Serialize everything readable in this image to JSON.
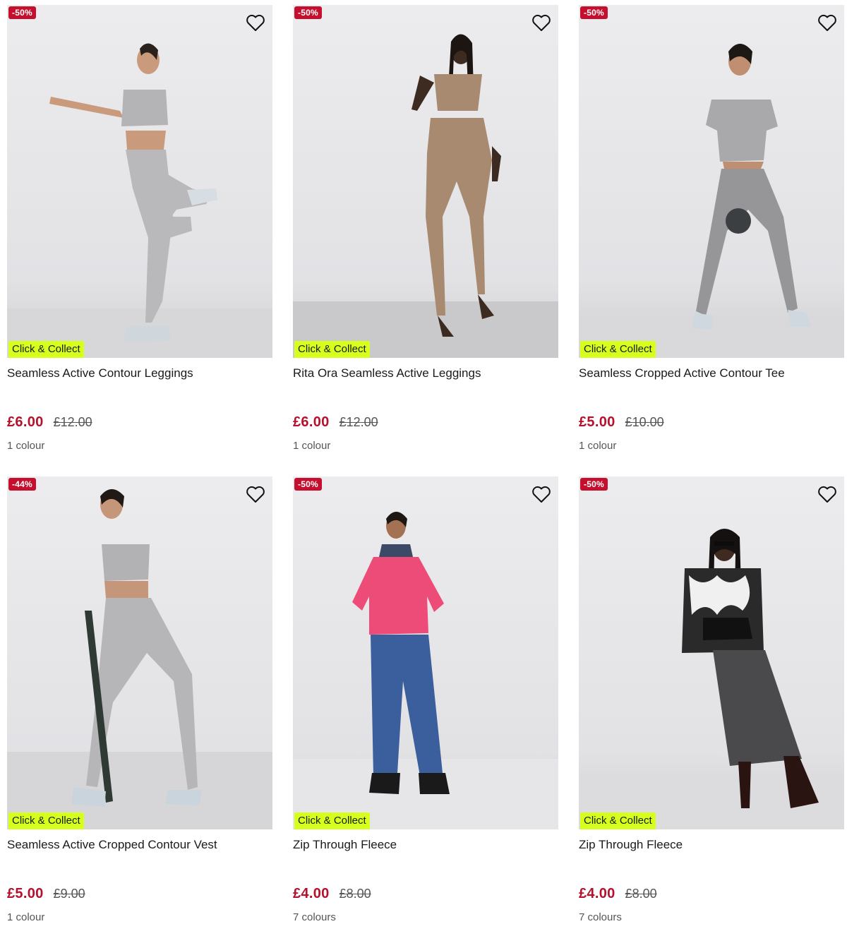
{
  "colors": {
    "badge": "#c4102e",
    "price_now": "#b5112c",
    "collect": "#d6ff1e"
  },
  "products": [
    {
      "badge": "-50%",
      "collect": "Click & Collect",
      "title": "Seamless Active Contour Leggings",
      "price_now": "£6.00",
      "price_was": "£12.00",
      "colours": "1 colour",
      "wishlist_icon": "heart-outline-icon"
    },
    {
      "badge": "-50%",
      "collect": "Click & Collect",
      "title": "Rita Ora Seamless Active Leggings",
      "price_now": "£6.00",
      "price_was": "£12.00",
      "colours": "1 colour",
      "wishlist_icon": "heart-outline-icon"
    },
    {
      "badge": "-50%",
      "collect": "Click & Collect",
      "title": "Seamless Cropped Active Contour Tee",
      "price_now": "£5.00",
      "price_was": "£10.00",
      "colours": "1 colour",
      "wishlist_icon": "heart-outline-icon"
    },
    {
      "badge": "-44%",
      "collect": "Click & Collect",
      "title": "Seamless Active Cropped Contour Vest",
      "price_now": "£5.00",
      "price_was": "£9.00",
      "colours": "1 colour",
      "wishlist_icon": "heart-outline-icon"
    },
    {
      "badge": "-50%",
      "collect": "Click & Collect",
      "title": "Zip Through Fleece",
      "price_now": "£4.00",
      "price_was": "£8.00",
      "colours": "7 colours",
      "wishlist_icon": "heart-outline-icon"
    },
    {
      "badge": "-50%",
      "collect": "Click & Collect",
      "title": "Zip Through Fleece",
      "price_now": "£4.00",
      "price_was": "£8.00",
      "colours": "7 colours",
      "wishlist_icon": "heart-outline-icon"
    }
  ]
}
